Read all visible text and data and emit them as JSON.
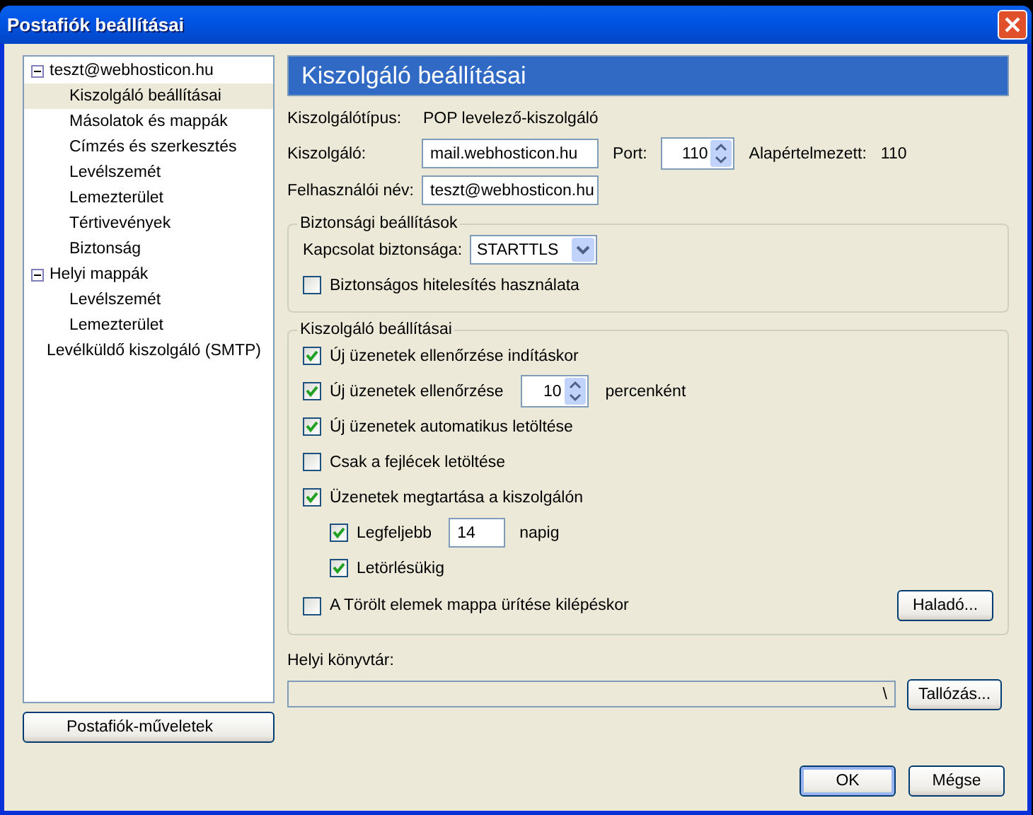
{
  "window": {
    "title": "Postafiók beállításai"
  },
  "tree": [
    {
      "label": "teszt@webhosticon.hu",
      "expanded": true,
      "selected": false,
      "children": [
        {
          "label": "Kiszolgáló beállításai",
          "selected": true
        },
        {
          "label": "Másolatok és mappák",
          "selected": false
        },
        {
          "label": "Címzés és szerkesztés",
          "selected": false
        },
        {
          "label": "Levélszemét",
          "selected": false
        },
        {
          "label": "Lemezterület",
          "selected": false
        },
        {
          "label": "Tértivevények",
          "selected": false
        },
        {
          "label": "Biztonság",
          "selected": false
        }
      ]
    },
    {
      "label": "Helyi mappák",
      "expanded": true,
      "selected": false,
      "children": [
        {
          "label": "Levélszemét",
          "selected": false
        },
        {
          "label": "Lemezterület",
          "selected": false
        }
      ]
    },
    {
      "label": "Levélküldő kiszolgáló (SMTP)",
      "selected": false
    }
  ],
  "account_actions_button": "Postafiók-műveletek",
  "panel_title": "Kiszolgáló beállításai",
  "server_type": {
    "label": "Kiszolgálótípus:",
    "value": "POP levelező-kiszolgáló"
  },
  "server": {
    "label": "Kiszolgáló:",
    "value": "mail.webhosticon.hu"
  },
  "port": {
    "label": "Port:",
    "value": "110",
    "default_label": "Alapértelmezett:",
    "default_value": "110"
  },
  "username": {
    "label": "Felhasználói név:",
    "value": "teszt@webhosticon.hu"
  },
  "security": {
    "title": "Biztonsági beállítások",
    "connection_label": "Kapcsolat biztonsága:",
    "connection_value": "STARTTLS",
    "secure_auth": {
      "label": "Biztonságos hitelesítés használata",
      "checked": false
    }
  },
  "server_settings": {
    "title": "Kiszolgáló beállításai",
    "options": [
      {
        "kind": "check",
        "label": "Új üzenetek ellenőrzése indításkor",
        "checked": true
      },
      {
        "kind": "spin",
        "label": "Új üzenetek ellenőrzése",
        "checked": true,
        "value": "10",
        "suffix": "percenként"
      },
      {
        "kind": "check",
        "label": "Új üzenetek automatikus letöltése",
        "checked": true
      },
      {
        "kind": "check",
        "label": "Csak a fejlécek letöltése",
        "checked": false
      },
      {
        "kind": "check",
        "label": "Üzenetek megtartása a kiszolgálón",
        "checked": true,
        "children": [
          {
            "kind": "field",
            "label": "Legfeljebb",
            "checked": true,
            "value": "14",
            "suffix": "napig"
          },
          {
            "kind": "check",
            "label": "Letörlésükig",
            "checked": true
          }
        ]
      },
      {
        "kind": "check",
        "label": "A Törölt elemek mappa ürítése kilépéskor",
        "checked": false
      }
    ],
    "advanced_button": "Haladó..."
  },
  "local_directory": {
    "label": "Helyi könyvtár:",
    "value": "\\",
    "browse_button": "Tallózás..."
  },
  "buttons": [
    {
      "label": "OK",
      "default": true
    },
    {
      "label": "Mégse",
      "default": false
    }
  ]
}
